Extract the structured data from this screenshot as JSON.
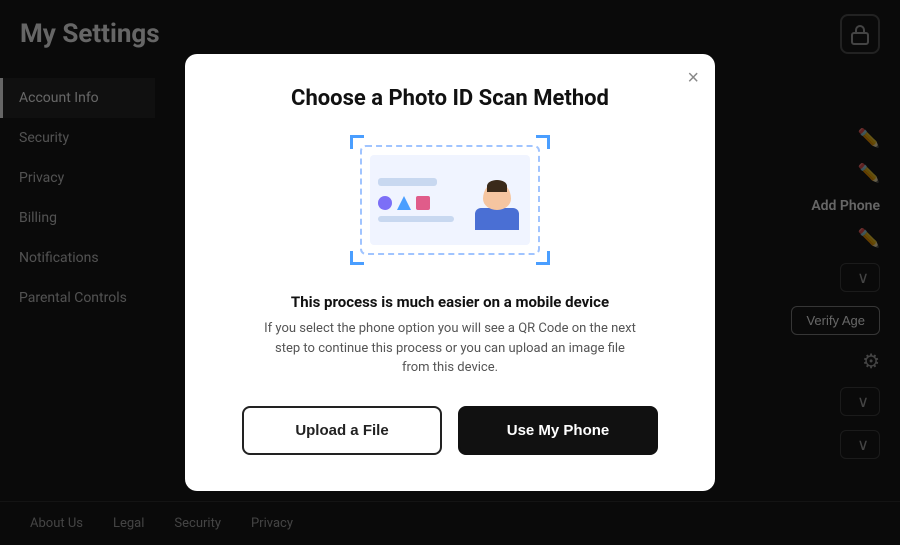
{
  "page": {
    "title": "My Settings"
  },
  "sidebar": {
    "items": [
      {
        "label": "Account Info",
        "active": true
      },
      {
        "label": "Security",
        "active": false
      },
      {
        "label": "Privacy",
        "active": false
      },
      {
        "label": "Billing",
        "active": false
      },
      {
        "label": "Notifications",
        "active": false
      },
      {
        "label": "Parental Controls",
        "active": false
      }
    ]
  },
  "footer": {
    "items": [
      "About Us",
      "Legal",
      "Security",
      "Privacy"
    ]
  },
  "background": {
    "add_phone_label": "Add Phone",
    "verify_age_btn": "Verify Age"
  },
  "modal": {
    "title": "Choose a Photo ID Scan Method",
    "close_label": "×",
    "info_title": "This process is much easier on a mobile device",
    "info_desc": "If you select the phone option you will see a QR Code on the next step to continue this process or you can upload an image file from this device.",
    "upload_btn": "Upload a File",
    "phone_btn": "Use My Phone"
  }
}
